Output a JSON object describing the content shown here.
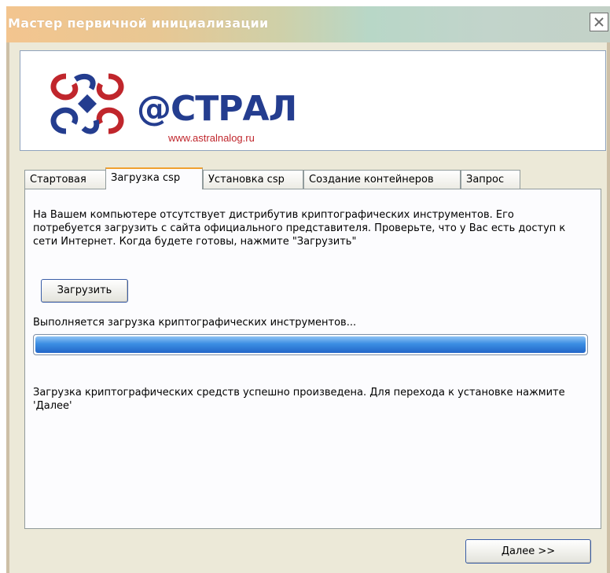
{
  "window": {
    "title": "Мастер первичной инициализации"
  },
  "logo": {
    "brand": "@СТРАЛ",
    "url": "www.astralnalog.ru"
  },
  "tabs": [
    "Стартовая",
    "Загрузка csp",
    "Установка csp",
    "Создание контейнеров",
    "Запрос"
  ],
  "active_tab": "Загрузка csp",
  "panel": {
    "info_text": "На Вашем компьютере отсутствует дистрибутив криптографических инструментов. Его потребуется загрузить с сайта официального представителя. Проверьте, что у Вас есть доступ к сети Интернет. Когда будете готовы, нажмите \"Загрузить\"",
    "load_button": "Загрузить",
    "progress_label": "Выполняется загрузка криптографических инструментов...",
    "progress": 1.0,
    "success_text": "Загрузка криптографических средств успешно произведена. Для перехода к установке нажмите 'Далее'"
  },
  "footer": {
    "next_button": "Далее >>"
  },
  "icons": {
    "close": "close-icon",
    "logo": "astral-logo-icon"
  },
  "colors": {
    "brand_blue": "#243d8f",
    "brand_red": "#c0262c",
    "progress": "#2e7bdb",
    "tab_highlight": "#f0a030"
  }
}
